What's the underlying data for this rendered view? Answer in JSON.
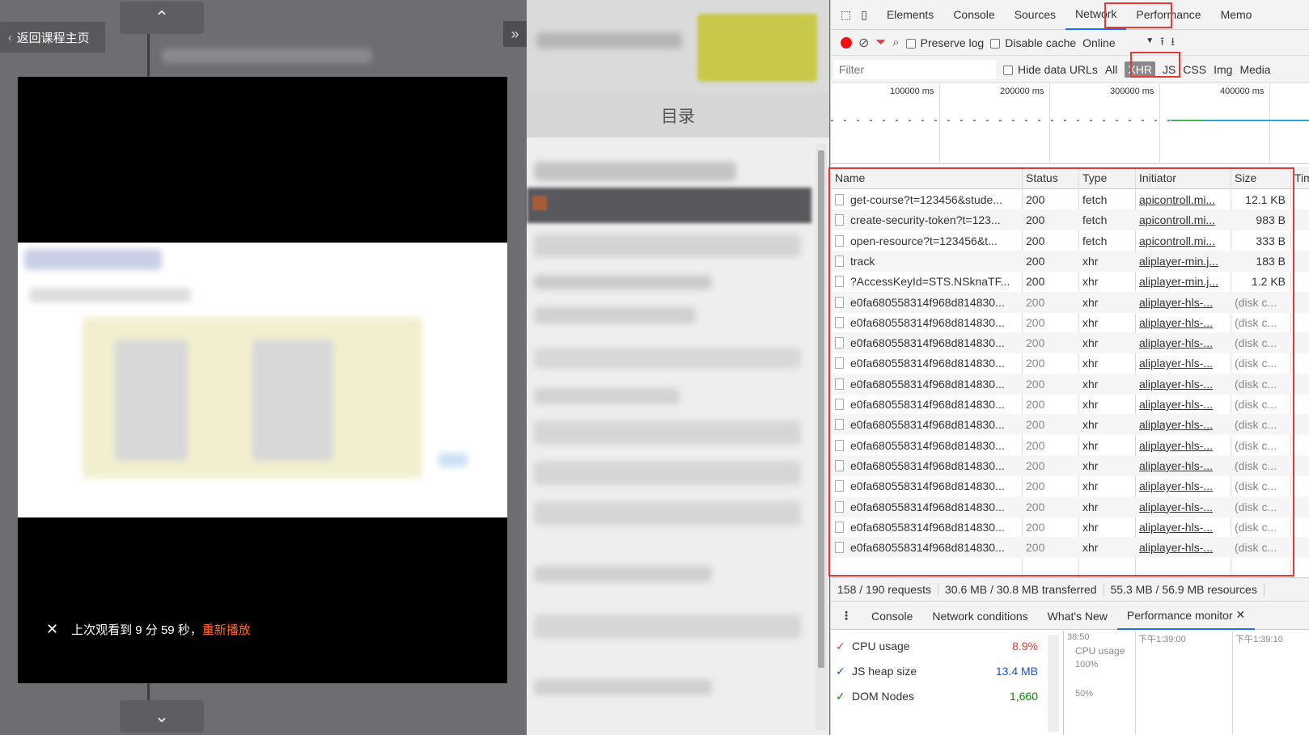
{
  "left": {
    "back_label": "返回课程主页",
    "resume_text": "上次观看到 9 分 59 秒，",
    "resume_action": "重新播放",
    "up_arrow": "⌃",
    "down_arrow": "⌄",
    "collapse": "»"
  },
  "middle": {
    "toc_title": "目录"
  },
  "devtools": {
    "tabs": [
      "Elements",
      "Console",
      "Sources",
      "Network",
      "Performance",
      "Memo"
    ],
    "active_tab": "Network",
    "toolbar": {
      "preserve_log": "Preserve log",
      "disable_cache": "Disable cache",
      "throttle": "Online"
    },
    "filter_placeholder": "Filter",
    "hide_data_urls": "Hide data URLs",
    "types": [
      "All",
      "XHR",
      "JS",
      "CSS",
      "Img",
      "Media"
    ],
    "selected_type": "XHR",
    "timeline_ticks": [
      "100000 ms",
      "200000 ms",
      "300000 ms",
      "400000 ms"
    ],
    "columns": [
      "Name",
      "Status",
      "Type",
      "Initiator",
      "Size",
      "Tim"
    ],
    "rows": [
      {
        "name": "get-course?t=123456&stude...",
        "status": "200",
        "type": "fetch",
        "initiator": "apicontroll.mi...",
        "size": "12.1 KB"
      },
      {
        "name": "create-security-token?t=123...",
        "status": "200",
        "type": "fetch",
        "initiator": "apicontroll.mi...",
        "size": "983 B"
      },
      {
        "name": "open-resource?t=123456&t...",
        "status": "200",
        "type": "fetch",
        "initiator": "apicontroll.mi...",
        "size": "333 B"
      },
      {
        "name": "track",
        "status": "200",
        "type": "xhr",
        "initiator": "aliplayer-min.j...",
        "size": "183 B"
      },
      {
        "name": "?AccessKeyId=STS.NSknaTF...",
        "status": "200",
        "type": "xhr",
        "initiator": "aliplayer-min.j...",
        "size": "1.2 KB"
      },
      {
        "name": "e0fa680558314f968d814830...",
        "status": "200",
        "type": "xhr",
        "initiator": "aliplayer-hls-...",
        "size": "(disk c..."
      },
      {
        "name": "e0fa680558314f968d814830...",
        "status": "200",
        "type": "xhr",
        "initiator": "aliplayer-hls-...",
        "size": "(disk c..."
      },
      {
        "name": "e0fa680558314f968d814830...",
        "status": "200",
        "type": "xhr",
        "initiator": "aliplayer-hls-...",
        "size": "(disk c..."
      },
      {
        "name": "e0fa680558314f968d814830...",
        "status": "200",
        "type": "xhr",
        "initiator": "aliplayer-hls-...",
        "size": "(disk c..."
      },
      {
        "name": "e0fa680558314f968d814830...",
        "status": "200",
        "type": "xhr",
        "initiator": "aliplayer-hls-...",
        "size": "(disk c..."
      },
      {
        "name": "e0fa680558314f968d814830...",
        "status": "200",
        "type": "xhr",
        "initiator": "aliplayer-hls-...",
        "size": "(disk c..."
      },
      {
        "name": "e0fa680558314f968d814830...",
        "status": "200",
        "type": "xhr",
        "initiator": "aliplayer-hls-...",
        "size": "(disk c..."
      },
      {
        "name": "e0fa680558314f968d814830...",
        "status": "200",
        "type": "xhr",
        "initiator": "aliplayer-hls-...",
        "size": "(disk c..."
      },
      {
        "name": "e0fa680558314f968d814830...",
        "status": "200",
        "type": "xhr",
        "initiator": "aliplayer-hls-...",
        "size": "(disk c..."
      },
      {
        "name": "e0fa680558314f968d814830...",
        "status": "200",
        "type": "xhr",
        "initiator": "aliplayer-hls-...",
        "size": "(disk c..."
      },
      {
        "name": "e0fa680558314f968d814830...",
        "status": "200",
        "type": "xhr",
        "initiator": "aliplayer-hls-...",
        "size": "(disk c..."
      },
      {
        "name": "e0fa680558314f968d814830...",
        "status": "200",
        "type": "xhr",
        "initiator": "aliplayer-hls-...",
        "size": "(disk c..."
      },
      {
        "name": "e0fa680558314f968d814830...",
        "status": "200",
        "type": "xhr",
        "initiator": "aliplayer-hls-...",
        "size": "(disk c..."
      }
    ],
    "summary": [
      "158 / 190 requests",
      "30.6 MB / 30.8 MB transferred",
      "55.3 MB / 56.9 MB resources"
    ],
    "drawer_tabs": [
      "Console",
      "Network conditions",
      "What's New",
      "Performance monitor"
    ],
    "drawer_active": "Performance monitor",
    "metrics": [
      {
        "name": "CPU usage",
        "value": "8.9%",
        "color": "#e53935"
      },
      {
        "name": "JS heap size",
        "value": "13.4 MB",
        "color": "#1a4fd8"
      },
      {
        "name": "DOM Nodes",
        "value": "1,660",
        "color": "#0a8a00"
      }
    ],
    "monitor_times": [
      "38:50",
      "下午1:39:00",
      "下午1:39:10"
    ],
    "monitor_label": "CPU usage",
    "monitor_scale": [
      "100%",
      "50%"
    ]
  }
}
